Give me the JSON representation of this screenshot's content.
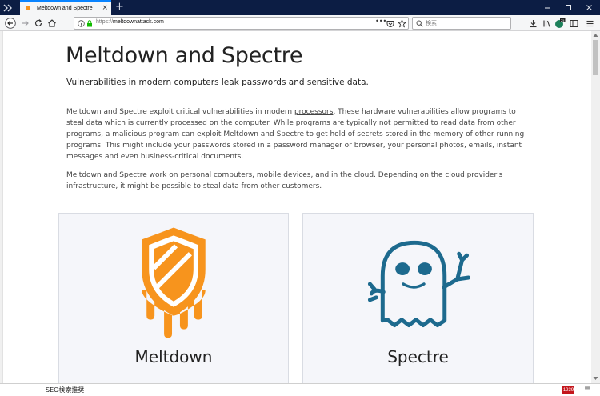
{
  "browser": {
    "tab_title": "Meltdown and Spectre",
    "tab_close": "×",
    "new_tab": "+",
    "url_protocol": "https://",
    "url_domain": "meltdownattack.com",
    "page_actions": "•••",
    "search_placeholder": "検索",
    "colors": {
      "titlebar": "#0c1d44",
      "toolbar": "#f5f6f7",
      "tab_accent": "#0a84ff"
    }
  },
  "page": {
    "title": "Meltdown and Spectre",
    "subtitle": "Vulnerabilities in modern computers leak passwords and sensitive data.",
    "para1_before_link": "Meltdown and Spectre exploit critical vulnerabilities in modern ",
    "para1_link": "processors",
    "para1_after_link": ". These hardware vulnerabilities allow programs to steal data which is currently processed on the computer. While programs are typically not permitted to read data from other programs, a malicious program can exploit Meltdown and Spectre to get hold of secrets stored in the memory of other running programs. This might include your passwords stored in a password manager or browser, your personal photos, emails, instant messages and even business-critical documents.",
    "para2": "Meltdown and Spectre work on personal computers, mobile devices, and in the cloud. Depending on the cloud provider's infrastructure, it might be possible to steal data from other customers.",
    "cards": [
      {
        "title": "Meltdown",
        "logo": "meltdown-shield-logo",
        "color": "#f7941d"
      },
      {
        "title": "Spectre",
        "logo": "spectre-ghost-logo",
        "color": "#1d6a8e"
      }
    ]
  },
  "status_bar": {
    "text": "SEO検索推奨",
    "badge": "1239",
    "menu_glyph": "≡"
  }
}
